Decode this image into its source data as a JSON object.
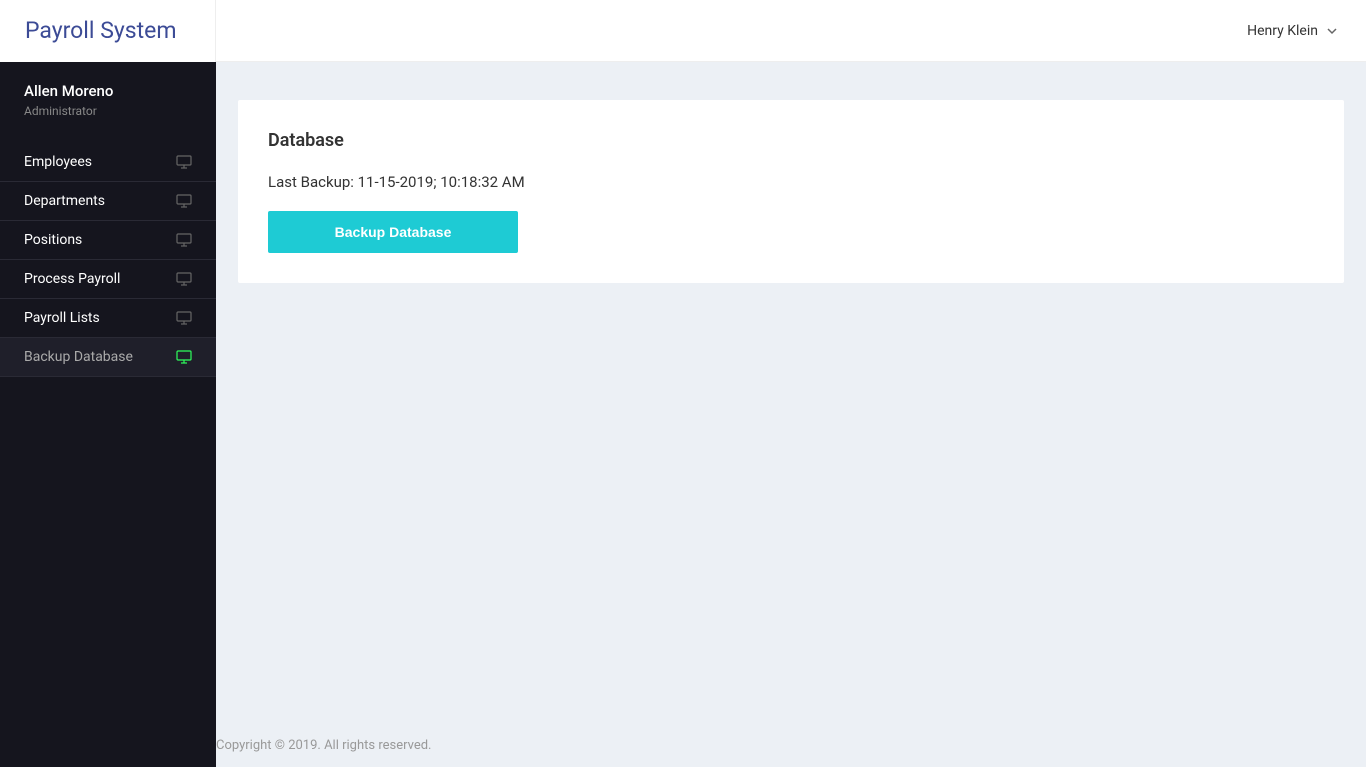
{
  "header": {
    "app_title": "Payroll System",
    "user_name": "Henry Klein"
  },
  "sidebar": {
    "user_name": "Allen Moreno",
    "user_role": "Administrator",
    "items": [
      {
        "label": "Employees",
        "active": false
      },
      {
        "label": "Departments",
        "active": false
      },
      {
        "label": "Positions",
        "active": false
      },
      {
        "label": "Process Payroll",
        "active": false
      },
      {
        "label": "Payroll Lists",
        "active": false
      },
      {
        "label": "Backup Database",
        "active": true
      }
    ]
  },
  "main": {
    "card_title": "Database",
    "last_backup_text": "Last Backup: 11-15-2019; 10:18:32 AM",
    "button_label": "Backup Database"
  },
  "footer": {
    "text": "Copyright © 2019. All rights reserved."
  }
}
